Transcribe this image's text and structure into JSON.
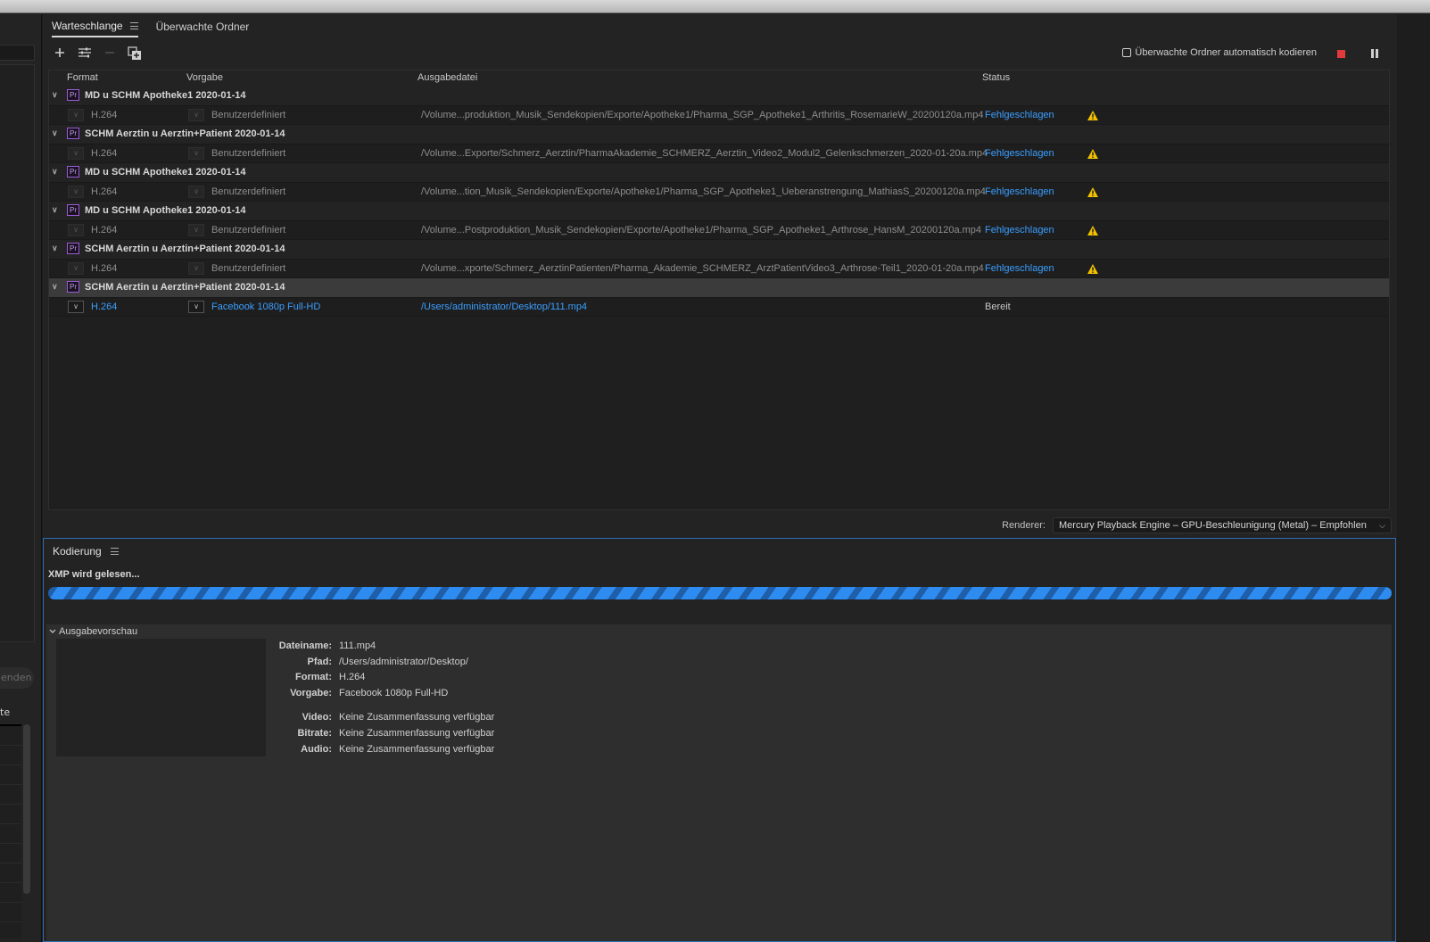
{
  "window": {
    "title": ""
  },
  "left": {
    "pill_text": "enden",
    "label": "te"
  },
  "tabs": [
    {
      "label": "Warteschlange",
      "active": true
    },
    {
      "label": "Überwachte Ordner",
      "active": false
    }
  ],
  "toolbar": {
    "auto_encode_label": "Überwachte Ordner automatisch kodieren"
  },
  "table": {
    "headers": {
      "format": "Format",
      "preset": "Vorgabe",
      "output": "Ausgabedatei",
      "status": "Status"
    },
    "groups": [
      {
        "name": "MD u SCHM Apotheke1 2020-01-14",
        "format": "H.264",
        "preset": "Benutzerdefiniert",
        "output": "/Volume...produktion_Musik_Sendekopien/Exporte/Apotheke1/Pharma_SGP_Apotheke1_Arthritis_RosemarieW_20200120a.mp4",
        "status": "Fehlgeschlagen",
        "state": "failed"
      },
      {
        "name": "SCHM Aerztin u Aerztin+Patient 2020-01-14",
        "format": "H.264",
        "preset": "Benutzerdefiniert",
        "output": "/Volume...Exporte/Schmerz_Aerztin/PharmaAkademie_SCHMERZ_Aerztin_Video2_Modul2_Gelenkschmerzen_2020-01-20a.mp4",
        "status": "Fehlgeschlagen",
        "state": "failed"
      },
      {
        "name": "MD u SCHM Apotheke1 2020-01-14",
        "format": "H.264",
        "preset": "Benutzerdefiniert",
        "output": "/Volume...tion_Musik_Sendekopien/Exporte/Apotheke1/Pharma_SGP_Apotheke1_Ueberanstrengung_MathiasS_20200120a.mp4",
        "status": "Fehlgeschlagen",
        "state": "failed"
      },
      {
        "name": "MD u SCHM Apotheke1 2020-01-14",
        "format": "H.264",
        "preset": "Benutzerdefiniert",
        "output": "/Volume...Postproduktion_Musik_Sendekopien/Exporte/Apotheke1/Pharma_SGP_Apotheke1_Arthrose_HansM_20200120a.mp4",
        "status": "Fehlgeschlagen",
        "state": "failed"
      },
      {
        "name": "SCHM Aerztin u Aerztin+Patient 2020-01-14",
        "format": "H.264",
        "preset": "Benutzerdefiniert",
        "output": "/Volume...xporte/Schmerz_AerztinPatienten/Pharma_Akademie_SCHMERZ_ArztPatientVideo3_Arthrose-Teil1_2020-01-20a.mp4",
        "status": "Fehlgeschlagen",
        "state": "failed"
      },
      {
        "name": "SCHM Aerztin u Aerztin+Patient 2020-01-14",
        "format": "H.264",
        "preset": "Facebook 1080p Full-HD",
        "output": "/Users/administrator/Desktop/111.mp4",
        "status": "Bereit",
        "state": "ready"
      }
    ]
  },
  "renderer": {
    "label": "Renderer:",
    "value": "Mercury Playback Engine – GPU-Beschleunigung (Metal) – Empfohlen"
  },
  "encoding": {
    "title": "Kodierung",
    "status_text": "XMP wird gelesen...",
    "preview_header": "Ausgabevorschau",
    "details": [
      {
        "key": "Dateiname:",
        "value": "111.mp4"
      },
      {
        "key": "Pfad:",
        "value": "/Users/administrator/Desktop/"
      },
      {
        "key": "Format:",
        "value": "H.264"
      },
      {
        "key": "Vorgabe:",
        "value": "Facebook 1080p Full-HD"
      },
      {
        "key": "Video:",
        "value": "Keine Zusammenfassung verfügbar"
      },
      {
        "key": "Bitrate:",
        "value": "Keine Zusammenfassung verfügbar"
      },
      {
        "key": "Audio:",
        "value": "Keine Zusammenfassung verfügbar"
      }
    ]
  },
  "colors": {
    "accent": "#3a9eff",
    "stop": "#e03a3a",
    "premiere": "#9b5bd6",
    "warning": "#f2c200",
    "focus_border": "#2d6fb3"
  }
}
